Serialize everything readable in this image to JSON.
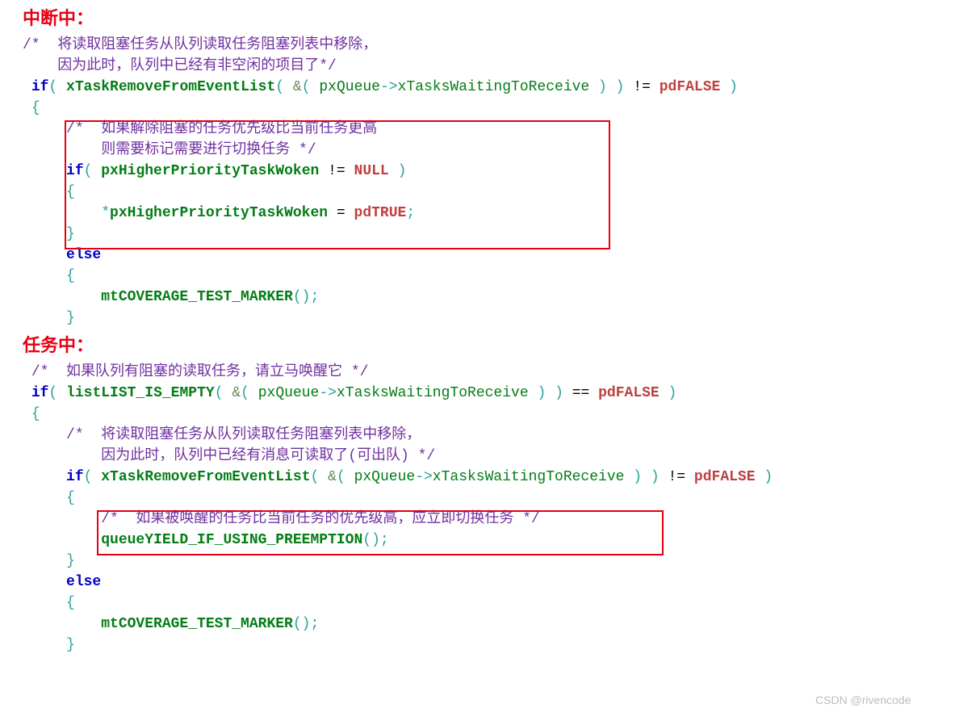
{
  "headings": {
    "interrupt": "中断中：",
    "task": "任务中："
  },
  "code1": {
    "comment1a": "/*  将读取阻塞任务从队列读取任务阻塞列表中移除，",
    "comment1b": "    因为此时，队列中已经有非空闲的项目了*/",
    "kw_if": "if",
    "fn_removeEvent": "xTaskRemoveFromEventList",
    "id_pxQueue": "pxQueue",
    "arrow": "->",
    "id_waitingRecv": "xTasksWaitingToReceive",
    "op_ne": "!=",
    "id_pdFALSE": "pdFALSE",
    "brace_open": "{",
    "inner_comment_a": "/*  如果解除阻塞的任务优先级比当前任务更高",
    "inner_comment_b": "    则需要标记需要进行切换任务 */",
    "id_pxHigher": "pxHigherPriorityTaskWoken",
    "id_NULL": "NULL",
    "id_pdTRUE": "pdTRUE",
    "kw_else": "else",
    "fn_marker": "mtCOVERAGE_TEST_MARKER",
    "brace_close": "}",
    "semi": ";",
    "star": "*",
    "amp": "&",
    "eq": "="
  },
  "code2": {
    "comment_top": "/*  如果队列有阻塞的读取任务，请立马唤醒它 */",
    "kw_if": "if",
    "fn_listEmpty": "listLIST_IS_EMPTY",
    "id_pxQueue": "pxQueue",
    "arrow": "->",
    "id_waitingRecv": "xTasksWaitingToReceive",
    "op_eq": "==",
    "id_pdFALSE": "pdFALSE",
    "brace_open": "{",
    "comment_inner1a": "/*  将读取阻塞任务从队列读取任务阻塞列表中移除，",
    "comment_inner1b": "    因为此时，队列中已经有消息可读取了(可出队) */",
    "fn_removeEvent": "xTaskRemoveFromEventList",
    "op_ne": "!=",
    "comment_box": "/*  如果被唤醒的任务比当前任务的优先级高，应立即切换任务 */",
    "fn_yield": "queueYIELD_IF_USING_PREEMPTION",
    "kw_else": "else",
    "fn_marker": "mtCOVERAGE_TEST_MARKER",
    "brace_close": "}",
    "amp": "&",
    "semi": ";"
  },
  "watermark": "CSDN @rivencode"
}
